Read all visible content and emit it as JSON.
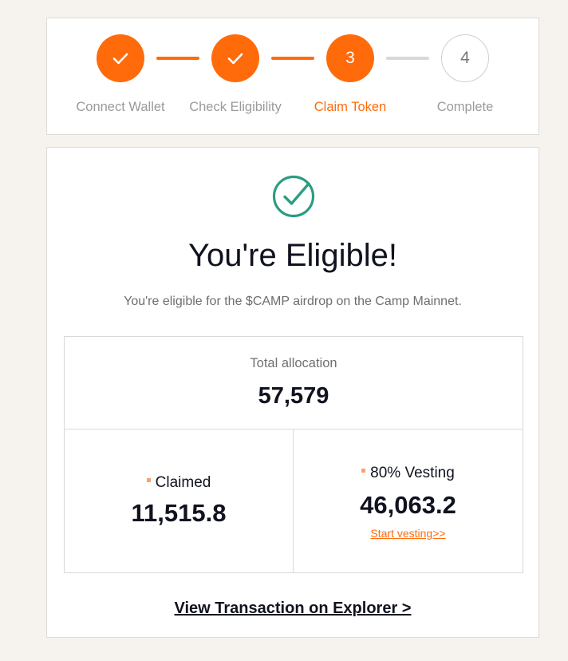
{
  "stepper": {
    "steps": [
      {
        "number": "1",
        "label": "Connect Wallet",
        "state": "done",
        "icon": "check-icon"
      },
      {
        "number": "2",
        "label": "Check Eligibility",
        "state": "done",
        "icon": "check-icon"
      },
      {
        "number": "3",
        "label": "Claim Token",
        "state": "active"
      },
      {
        "number": "4",
        "label": "Complete",
        "state": "pending"
      }
    ]
  },
  "result": {
    "icon": "check-circle-icon",
    "title": "You're Eligible!",
    "subtitle": "You're eligible for the $CAMP airdrop on the Camp Mainnet."
  },
  "allocation": {
    "total_label": "Total allocation",
    "total_value": "57,579",
    "claimed_label": "Claimed",
    "claimed_value": "11,515.8",
    "vesting_label": "80% Vesting",
    "vesting_value": "46,063.2",
    "vesting_link": "Start vesting>>"
  },
  "explorer_link": "View Transaction on Explorer >",
  "colors": {
    "accent": "#ff6b0b",
    "success": "#2a9d82",
    "background": "#f6f3ee",
    "text": "#10131f"
  }
}
